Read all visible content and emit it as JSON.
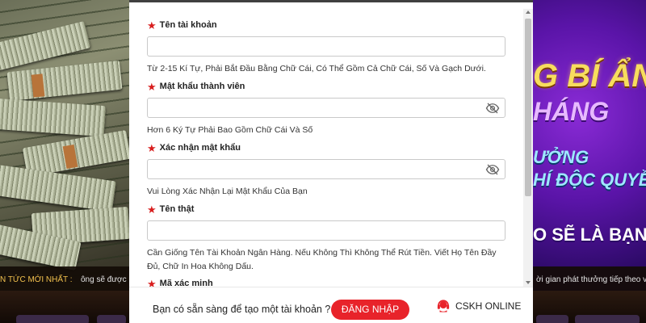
{
  "background": {
    "promo_line1": "G BÍ ẨN",
    "promo_line2": "HÁNG",
    "promo_line3": "ƯỞNG",
    "promo_line4": "HÍ ĐỘC QUYỀN",
    "promo_line5": "O SẼ LÀ BẠN",
    "ticker_label": "N TỨC MỚI NHẤT :",
    "ticker_left": "ông sẽ được p",
    "ticker_right": "ời gian phát thưởng tiếp theo vào n"
  },
  "form": {
    "fields": [
      {
        "label": "Tên tài khoản",
        "value": "",
        "hint": "Từ 2-15 Kí Tự, Phải Bắt Đầu Bằng Chữ Cái, Có Thể Gồm Cả Chữ Cái, Số Và Gạch Dưới."
      },
      {
        "label": "Mật khẩu thành viên",
        "value": "",
        "hint": "Hơn 6 Ký Tự Phải Bao Gồm Chữ Cái Và Số",
        "icon": "eye-slash-icon"
      },
      {
        "label": "Xác nhận mật khẩu",
        "value": "",
        "hint": "Vui Lòng Xác Nhận Lại Mật Khẩu Của Bạn",
        "icon": "eye-slash-icon"
      },
      {
        "label": "Tên thật",
        "value": "",
        "hint": "Cần Giống Tên Tài Khoản Ngân Hàng. Nếu Không Thì Không Thể Rút Tiền. Viết Họ Tên Đầy Đủ, Chữ In Hoa Không Dấu."
      },
      {
        "label": "Mã xác minh"
      }
    ]
  },
  "footer": {
    "prompt": "Bạn có sẵn sàng để tạo một tài khoản ?",
    "login_label": "ĐĂNG NHẬP",
    "support_label": "CSKH ONLINE"
  },
  "colors": {
    "accent": "#e8232a",
    "required_star": "#d81e1e"
  }
}
